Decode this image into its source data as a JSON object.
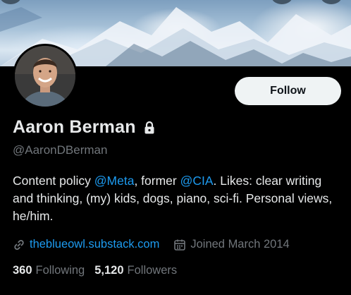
{
  "profile": {
    "name": "Aaron Berman",
    "handle": "@AaronDBerman",
    "follow_label": "Follow",
    "bio": {
      "part1": "Content policy ",
      "mention1": "@Meta",
      "part2": ", former ",
      "mention2": "@CIA",
      "part3": ". Likes: clear writing and thinking, (my) kids, dogs, piano, sci-fi. Personal views, he/him."
    },
    "website": "theblueowl.substack.com",
    "joined": "Joined March 2014",
    "following_count": "360",
    "following_label": "Following",
    "followers_count": "5,120",
    "followers_label": "Followers"
  },
  "icons": {
    "lock": "lock-icon",
    "link": "link-icon",
    "calendar": "calendar-icon"
  },
  "colors": {
    "background": "#000000",
    "accent": "#1d9bf0",
    "muted": "#71767b",
    "text": "#e7e9ea",
    "button_bg": "#eff3f4"
  }
}
